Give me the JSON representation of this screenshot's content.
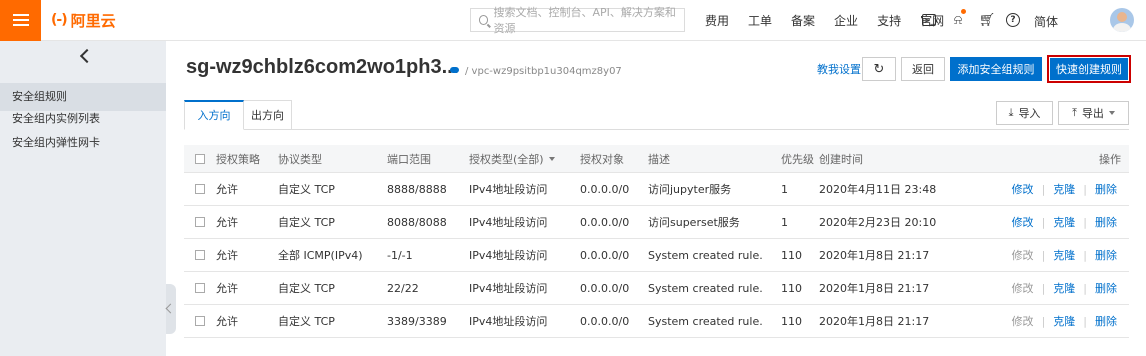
{
  "topbar": {
    "logo_mark": "(-)",
    "logo_text": "阿里云",
    "search_placeholder": "搜索文档、控制台、API、解决方案和资源",
    "nav": [
      "费用",
      "工单",
      "备案",
      "企业",
      "支持",
      "官网"
    ],
    "lang": "简体",
    "icons": [
      "menu-icon",
      "search-icon",
      "terminal-icon",
      "bell-icon",
      "cart-icon",
      "help-icon",
      "avatar"
    ],
    "accent": "#ff6a00"
  },
  "sidebar": {
    "items": [
      {
        "label": "安全组规则",
        "active": true
      },
      {
        "label": "安全组内实例列表",
        "active": false
      },
      {
        "label": "安全组内弹性网卡",
        "active": false
      }
    ]
  },
  "header": {
    "title": "sg-wz9chblz6com2wo1ph3...",
    "vpc": "/ vpc-wz9psitbp1u304qmz8y07",
    "tutorial": "教我设置",
    "refresh": "↻",
    "return_label": "返回",
    "add_label": "添加安全组规则",
    "quick_label": "快速创建规则"
  },
  "tabs": {
    "inbound": "入方向",
    "outbound": "出方向"
  },
  "actions": {
    "import_label": "导入",
    "export_label": "导出"
  },
  "table": {
    "columns": [
      "授权策略",
      "协议类型",
      "端口范围",
      "授权类型(全部)",
      "授权对象",
      "描述",
      "优先级",
      "创建时间",
      "操作"
    ],
    "rows": [
      {
        "policy": "允许",
        "protocol": "自定义 TCP",
        "port": "8888/8888",
        "auth_type": "IPv4地址段访问",
        "target": "0.0.0.0/0",
        "desc": "访问jupyter服务",
        "priority": "1",
        "created": "2020年4月11日 23:48",
        "edit": "修改",
        "clone": "克隆",
        "delete": "删除",
        "edit_enabled": true
      },
      {
        "policy": "允许",
        "protocol": "自定义 TCP",
        "port": "8088/8088",
        "auth_type": "IPv4地址段访问",
        "target": "0.0.0.0/0",
        "desc": "访问superset服务",
        "priority": "1",
        "created": "2020年2月23日 20:10",
        "edit": "修改",
        "clone": "克隆",
        "delete": "删除",
        "edit_enabled": true
      },
      {
        "policy": "允许",
        "protocol": "全部 ICMP(IPv4)",
        "port": "-1/-1",
        "auth_type": "IPv4地址段访问",
        "target": "0.0.0.0/0",
        "desc": "System created rule.",
        "priority": "110",
        "created": "2020年1月8日 21:17",
        "edit": "修改",
        "clone": "克隆",
        "delete": "删除",
        "edit_enabled": false
      },
      {
        "policy": "允许",
        "protocol": "自定义 TCP",
        "port": "22/22",
        "auth_type": "IPv4地址段访问",
        "target": "0.0.0.0/0",
        "desc": "System created rule.",
        "priority": "110",
        "created": "2020年1月8日 21:17",
        "edit": "修改",
        "clone": "克隆",
        "delete": "删除",
        "edit_enabled": false
      },
      {
        "policy": "允许",
        "protocol": "自定义 TCP",
        "port": "3389/3389",
        "auth_type": "IPv4地址段访问",
        "target": "0.0.0.0/0",
        "desc": "System created rule.",
        "priority": "110",
        "created": "2020年1月8日 21:17",
        "edit": "修改",
        "clone": "克隆",
        "delete": "删除",
        "edit_enabled": false
      }
    ]
  },
  "colors": {
    "primary": "#0070cc",
    "highlight_border": "#cc0000",
    "disabled": "#999999"
  }
}
